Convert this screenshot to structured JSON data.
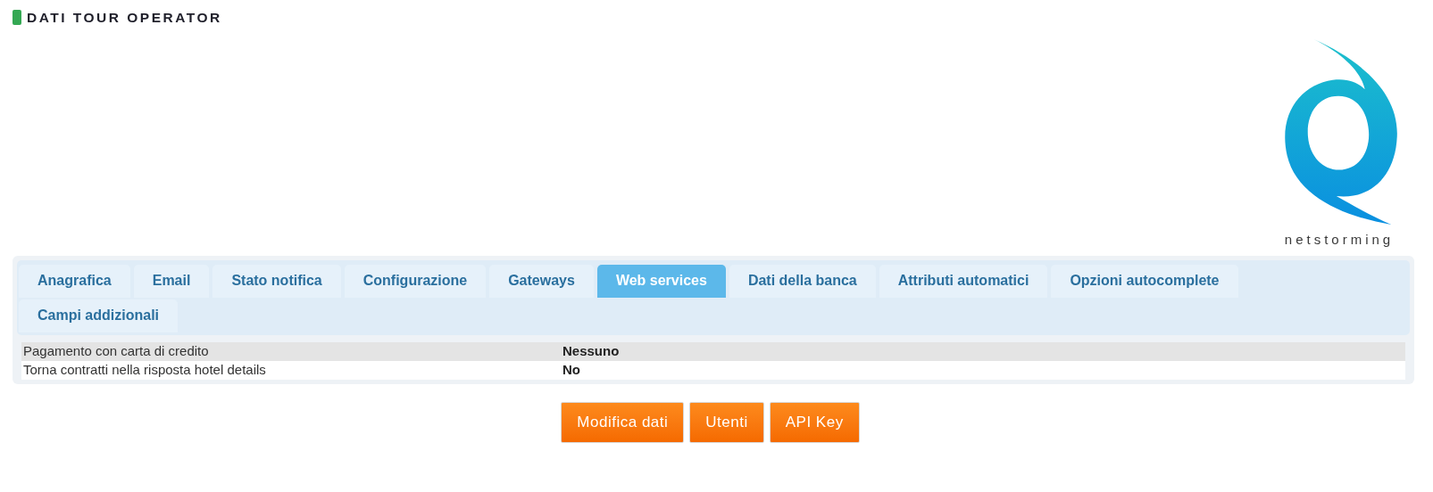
{
  "header": {
    "title": "DATI TOUR OPERATOR"
  },
  "logo": {
    "text": "netstorming"
  },
  "tabs": [
    {
      "label": "Anagrafica",
      "selected": false
    },
    {
      "label": "Email",
      "selected": false
    },
    {
      "label": "Stato notifica",
      "selected": false
    },
    {
      "label": "Configurazione",
      "selected": false
    },
    {
      "label": "Gateways",
      "selected": false
    },
    {
      "label": "Web services",
      "selected": true
    },
    {
      "label": "Dati della banca",
      "selected": false
    },
    {
      "label": "Attributi automatici",
      "selected": false
    },
    {
      "label": "Opzioni autocomplete",
      "selected": false
    },
    {
      "label": "Campi addizionali",
      "selected": false
    }
  ],
  "rows": [
    {
      "label": "Pagamento con carta di credito",
      "value": "Nessuno"
    },
    {
      "label": "Torna contratti nella risposta hotel details",
      "value": "No"
    }
  ],
  "buttons": [
    "Modifica dati",
    "Utenti",
    "API Key"
  ]
}
